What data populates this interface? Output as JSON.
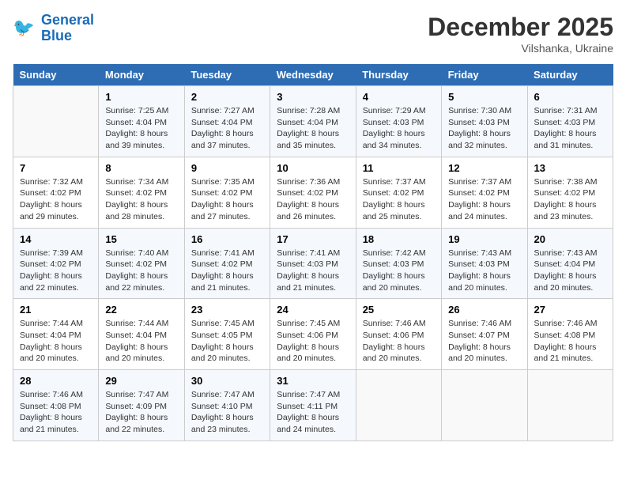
{
  "header": {
    "logo_line1": "General",
    "logo_line2": "Blue",
    "month_title": "December 2025",
    "subtitle": "Vilshanka, Ukraine"
  },
  "days_of_week": [
    "Sunday",
    "Monday",
    "Tuesday",
    "Wednesday",
    "Thursday",
    "Friday",
    "Saturday"
  ],
  "weeks": [
    [
      {
        "num": "",
        "info": ""
      },
      {
        "num": "1",
        "info": "Sunrise: 7:25 AM\nSunset: 4:04 PM\nDaylight: 8 hours\nand 39 minutes."
      },
      {
        "num": "2",
        "info": "Sunrise: 7:27 AM\nSunset: 4:04 PM\nDaylight: 8 hours\nand 37 minutes."
      },
      {
        "num": "3",
        "info": "Sunrise: 7:28 AM\nSunset: 4:04 PM\nDaylight: 8 hours\nand 35 minutes."
      },
      {
        "num": "4",
        "info": "Sunrise: 7:29 AM\nSunset: 4:03 PM\nDaylight: 8 hours\nand 34 minutes."
      },
      {
        "num": "5",
        "info": "Sunrise: 7:30 AM\nSunset: 4:03 PM\nDaylight: 8 hours\nand 32 minutes."
      },
      {
        "num": "6",
        "info": "Sunrise: 7:31 AM\nSunset: 4:03 PM\nDaylight: 8 hours\nand 31 minutes."
      }
    ],
    [
      {
        "num": "7",
        "info": "Sunrise: 7:32 AM\nSunset: 4:02 PM\nDaylight: 8 hours\nand 29 minutes."
      },
      {
        "num": "8",
        "info": "Sunrise: 7:34 AM\nSunset: 4:02 PM\nDaylight: 8 hours\nand 28 minutes."
      },
      {
        "num": "9",
        "info": "Sunrise: 7:35 AM\nSunset: 4:02 PM\nDaylight: 8 hours\nand 27 minutes."
      },
      {
        "num": "10",
        "info": "Sunrise: 7:36 AM\nSunset: 4:02 PM\nDaylight: 8 hours\nand 26 minutes."
      },
      {
        "num": "11",
        "info": "Sunrise: 7:37 AM\nSunset: 4:02 PM\nDaylight: 8 hours\nand 25 minutes."
      },
      {
        "num": "12",
        "info": "Sunrise: 7:37 AM\nSunset: 4:02 PM\nDaylight: 8 hours\nand 24 minutes."
      },
      {
        "num": "13",
        "info": "Sunrise: 7:38 AM\nSunset: 4:02 PM\nDaylight: 8 hours\nand 23 minutes."
      }
    ],
    [
      {
        "num": "14",
        "info": "Sunrise: 7:39 AM\nSunset: 4:02 PM\nDaylight: 8 hours\nand 22 minutes."
      },
      {
        "num": "15",
        "info": "Sunrise: 7:40 AM\nSunset: 4:02 PM\nDaylight: 8 hours\nand 22 minutes."
      },
      {
        "num": "16",
        "info": "Sunrise: 7:41 AM\nSunset: 4:02 PM\nDaylight: 8 hours\nand 21 minutes."
      },
      {
        "num": "17",
        "info": "Sunrise: 7:41 AM\nSunset: 4:03 PM\nDaylight: 8 hours\nand 21 minutes."
      },
      {
        "num": "18",
        "info": "Sunrise: 7:42 AM\nSunset: 4:03 PM\nDaylight: 8 hours\nand 20 minutes."
      },
      {
        "num": "19",
        "info": "Sunrise: 7:43 AM\nSunset: 4:03 PM\nDaylight: 8 hours\nand 20 minutes."
      },
      {
        "num": "20",
        "info": "Sunrise: 7:43 AM\nSunset: 4:04 PM\nDaylight: 8 hours\nand 20 minutes."
      }
    ],
    [
      {
        "num": "21",
        "info": "Sunrise: 7:44 AM\nSunset: 4:04 PM\nDaylight: 8 hours\nand 20 minutes."
      },
      {
        "num": "22",
        "info": "Sunrise: 7:44 AM\nSunset: 4:04 PM\nDaylight: 8 hours\nand 20 minutes."
      },
      {
        "num": "23",
        "info": "Sunrise: 7:45 AM\nSunset: 4:05 PM\nDaylight: 8 hours\nand 20 minutes."
      },
      {
        "num": "24",
        "info": "Sunrise: 7:45 AM\nSunset: 4:06 PM\nDaylight: 8 hours\nand 20 minutes."
      },
      {
        "num": "25",
        "info": "Sunrise: 7:46 AM\nSunset: 4:06 PM\nDaylight: 8 hours\nand 20 minutes."
      },
      {
        "num": "26",
        "info": "Sunrise: 7:46 AM\nSunset: 4:07 PM\nDaylight: 8 hours\nand 20 minutes."
      },
      {
        "num": "27",
        "info": "Sunrise: 7:46 AM\nSunset: 4:08 PM\nDaylight: 8 hours\nand 21 minutes."
      }
    ],
    [
      {
        "num": "28",
        "info": "Sunrise: 7:46 AM\nSunset: 4:08 PM\nDaylight: 8 hours\nand 21 minutes."
      },
      {
        "num": "29",
        "info": "Sunrise: 7:47 AM\nSunset: 4:09 PM\nDaylight: 8 hours\nand 22 minutes."
      },
      {
        "num": "30",
        "info": "Sunrise: 7:47 AM\nSunset: 4:10 PM\nDaylight: 8 hours\nand 23 minutes."
      },
      {
        "num": "31",
        "info": "Sunrise: 7:47 AM\nSunset: 4:11 PM\nDaylight: 8 hours\nand 24 minutes."
      },
      {
        "num": "",
        "info": ""
      },
      {
        "num": "",
        "info": ""
      },
      {
        "num": "",
        "info": ""
      }
    ]
  ]
}
